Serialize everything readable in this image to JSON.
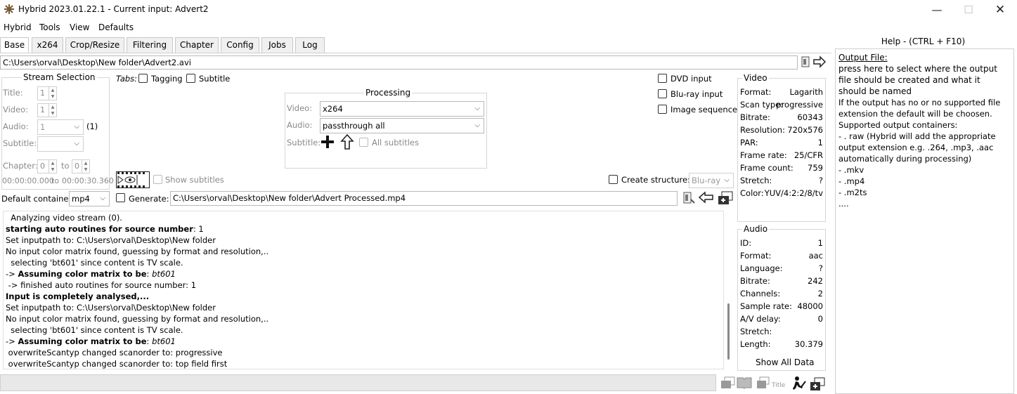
{
  "window": {
    "title": "Hybrid 2023.01.22.1 - Current input: Advert2",
    "minimize": "—",
    "maximize": "☐",
    "close": "✕"
  },
  "menu": [
    "Hybrid",
    "Tools",
    "View",
    "Defaults"
  ],
  "tabs": [
    "Base",
    "x264",
    "Crop/Resize",
    "Filtering",
    "Chapter",
    "Config",
    "Jobs",
    "Log"
  ],
  "input_path": "C:\\Users\\orval\\Desktop\\New folder\\Advert2.avi",
  "stream_selection": {
    "title": "Stream Selection",
    "title_label": "Title:",
    "title_value": "1",
    "video_label": "Video:",
    "video_value": "1",
    "audio_label": "Audio:",
    "audio_value": "1",
    "audio_count": "(1)",
    "subtitle_label": "Subtitle:",
    "chapter_label": "Chapter:",
    "chapter_from": "0",
    "chapter_to_label": "to",
    "chapter_to": "0",
    "time_from": "00:00:00.000",
    "time_to_label": "to",
    "time_to": "00:00:30.360"
  },
  "tabs_opts": {
    "label": "Tabs:",
    "tagging": "Tagging",
    "subtitle": "Subtitle"
  },
  "processing": {
    "title": "Processing",
    "video_label": "Video:",
    "video_value": "x264",
    "audio_label": "Audio:",
    "audio_value": "passthrough all",
    "subtitle_label": "Subtitle:",
    "all_subtitles": "All subtitles"
  },
  "show_subtitles": "Show subtitles",
  "source_opts": {
    "dvd": "DVD input",
    "bluray": "Blu-ray input",
    "image_seq": "Image sequence"
  },
  "create_structure": {
    "label": "Create structure:",
    "value": "Blu-ray"
  },
  "default_container": {
    "label": "Default container:",
    "value": "mp4"
  },
  "generate": {
    "label": "Generate:",
    "path": "C:\\Users\\orval\\Desktop\\New folder\\Advert Processed.mp4"
  },
  "video_info": {
    "title": "Video",
    "rows": [
      {
        "k": "Format:",
        "v": "Lagarith"
      },
      {
        "k": "Scan type:",
        "v": "progressive"
      },
      {
        "k": "Bitrate:",
        "v": "60343"
      },
      {
        "k": "Resolution:",
        "v": "720x576"
      },
      {
        "k": "PAR:",
        "v": "1"
      },
      {
        "k": "Frame rate:",
        "v": "25/CFR"
      },
      {
        "k": "Frame count:",
        "v": "759"
      },
      {
        "k": "Stretch:",
        "v": "?"
      },
      {
        "k": "Color:",
        "v": "YUV/4:2:2/8/tv"
      }
    ]
  },
  "audio_info": {
    "title": "Audio",
    "rows": [
      {
        "k": "ID:",
        "v": "1"
      },
      {
        "k": "Format:",
        "v": "aac"
      },
      {
        "k": "Language:",
        "v": "?"
      },
      {
        "k": "Bitrate:",
        "v": "242"
      },
      {
        "k": "Channels:",
        "v": "2"
      },
      {
        "k": "Sample rate:",
        "v": "48000"
      },
      {
        "k": "A/V delay:",
        "v": "0"
      },
      {
        "k": "Stretch:",
        "v": ""
      },
      {
        "k": "Length:",
        "v": "30.379"
      }
    ],
    "show_all": "Show All Data"
  },
  "log": [
    {
      "t": "  Analyzing video stream (0).",
      "b": ""
    },
    {
      "t": "starting auto routines for source number",
      "b": "bold",
      "rest": ": 1"
    },
    {
      "t": "Set inputpath to: C:\\Users\\orval\\Desktop\\New folder",
      "b": ""
    },
    {
      "t": "No input color matrix found, guessing by format and resolution,..",
      "b": ""
    },
    {
      "t": "  selecting 'bt601' since content is TV scale.",
      "b": ""
    },
    {
      "t": "-> Assuming color matrix to be",
      "b": "bold",
      "rest": ": ",
      "ital": "bt601"
    },
    {
      "t": " -> finished auto routines for source number: 1",
      "b": ""
    },
    {
      "t": "Input is completely analysed,...",
      "b": "boldall"
    },
    {
      "t": "Set inputpath to: C:\\Users\\orval\\Desktop\\New folder",
      "b": ""
    },
    {
      "t": "No input color matrix found, guessing by format and resolution,..",
      "b": ""
    },
    {
      "t": "  selecting 'bt601' since content is TV scale.",
      "b": ""
    },
    {
      "t": "-> Assuming color matrix to be",
      "b": "bold",
      "rest": ": ",
      "ital": "bt601"
    },
    {
      "t": " overwriteScantyp changed scanorder to: progressive",
      "b": ""
    },
    {
      "t": " overwriteScantyp changed scanorder to: top field first",
      "b": ""
    }
  ],
  "help": {
    "title": "Help - (CTRL + F10)",
    "heading": "Output File:",
    "lines": [
      "press here to select where the output file should be created and what it should be named",
      "If the output has no or no supported file extension the default will be choosen.",
      "Supported output containers:",
      "- . raw (Hybrid will add the appropriate output extension e.g. .264, .mp3, .aac automatically during processing)",
      "- .mkv",
      "- .mp4",
      "- .m2ts",
      "...."
    ]
  },
  "bottom_icons": {
    "title_label": "Title"
  }
}
